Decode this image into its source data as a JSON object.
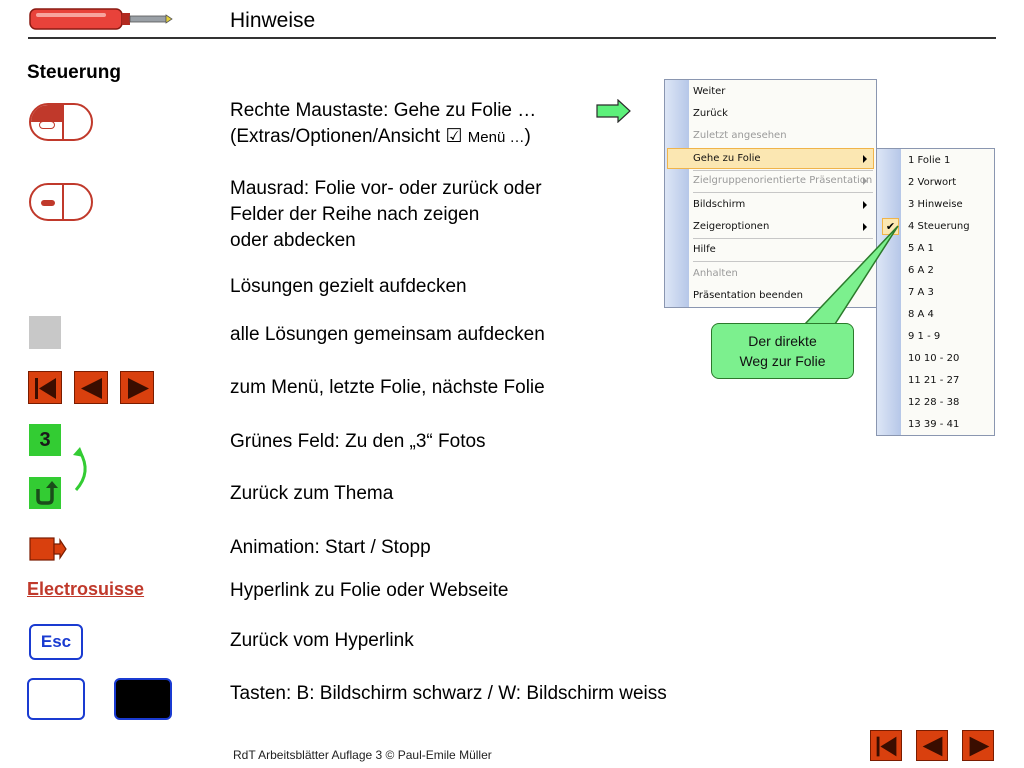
{
  "header": {
    "title": "Hinweise"
  },
  "section": {
    "title": "Steuerung"
  },
  "rows": {
    "right_mouse_line1": "Rechte Maustaste: Gehe zu Folie …",
    "right_mouse_line2_a": "(Extras/Optionen/Ansicht ",
    "right_mouse_check": "☑",
    "right_mouse_line2_b": "Menü …",
    "right_mouse_line2_c": ")",
    "wheel_line1": "Mausrad: Folie vor- oder zurück oder",
    "wheel_line2": "Felder der Reihe nach zeigen",
    "wheel_line3": "oder abdecken",
    "solutions_targeted": "Lösungen gezielt aufdecken",
    "solutions_all": "alle Lösungen gemeinsam aufdecken",
    "nav": "zum Menü, letzte Folie, nächste Folie",
    "green": "Grünes Feld: Zu den „3“ Fotos",
    "back": "Zurück zum Thema",
    "animation": "Animation: Start / Stopp",
    "hyperlink": "Hyperlink zu Folie oder Webseite",
    "esc": "Zurück vom Hyperlink",
    "keys": "Tasten: B: Bildschirm schwarz / W: Bildschirm weiss"
  },
  "icons": {
    "green_label": "3",
    "esc_label": "Esc",
    "link_text": "Electrosuisse"
  },
  "context_menu": {
    "items": [
      {
        "label": "Weiter",
        "disabled": false
      },
      {
        "label": "Zurück",
        "disabled": false
      },
      {
        "label": "Zuletzt angesehen",
        "disabled": true
      },
      {
        "label": "Gehe zu Folie",
        "disabled": false
      },
      {
        "label": "Zielgruppenorientierte Präsentation",
        "disabled": true
      },
      {
        "label": "Bildschirm",
        "disabled": false
      },
      {
        "label": "Zeigeroptionen",
        "disabled": false
      },
      {
        "label": "Hilfe",
        "disabled": false
      },
      {
        "label": "Anhalten",
        "disabled": true
      },
      {
        "label": "Präsentation beenden",
        "disabled": false
      }
    ]
  },
  "submenu": {
    "items": [
      "1 Folie 1",
      "2 Vorwort",
      "3 Hinweise",
      "4 Steuerung",
      "5 A 1",
      "6 A 2",
      "7 A 3",
      "8 A 4",
      "9 1 - 9",
      "10 10 - 20",
      "11 21 - 27",
      "12 28 - 38",
      "13 39 - 41"
    ],
    "checked_index": 3
  },
  "callout": {
    "line1": "Der direkte",
    "line2": "Weg zur Folie"
  },
  "footer": {
    "text": "RdT Arbeitsblätter  Auflage 3  © Paul-Emile Müller"
  },
  "colors": {
    "accent": "#d9400e",
    "green": "#33cc33",
    "blue": "#1a3bd1",
    "link": "#c0392b"
  }
}
